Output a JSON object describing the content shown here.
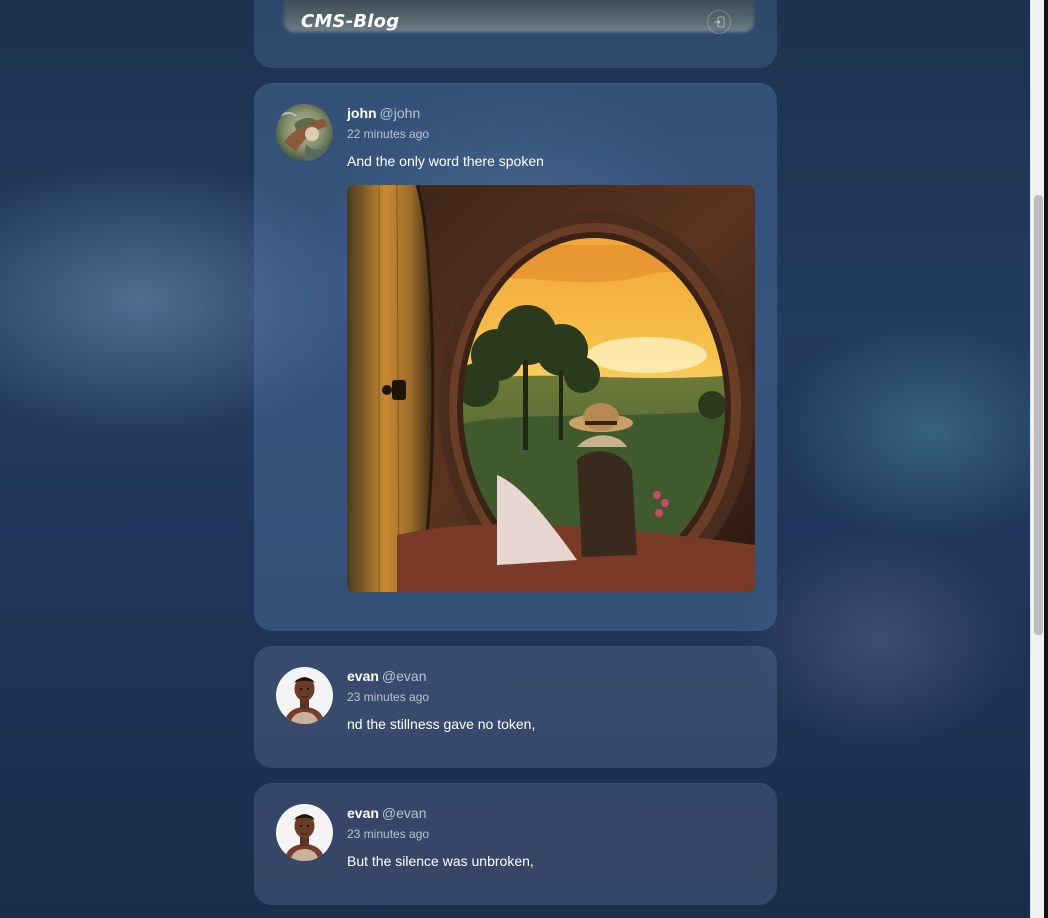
{
  "app": {
    "logo": "CMS-Blog",
    "login_icon": "login-icon"
  },
  "posts": [
    {
      "author": "john",
      "handle": "@john",
      "time": "22 minutes ago",
      "text": "And the only word there spoken",
      "has_image": true,
      "avatar_icon": "user-avatar-john"
    },
    {
      "author": "evan",
      "handle": "@evan",
      "time": "23 minutes ago",
      "text": "nd the stillness gave no token,",
      "has_image": false,
      "avatar_icon": "user-avatar-evan"
    },
    {
      "author": "evan",
      "handle": "@evan",
      "time": "23 minutes ago",
      "text": "But the silence was unbroken,",
      "has_image": false,
      "avatar_icon": "user-avatar-evan"
    }
  ],
  "colors": {
    "background": "#213659",
    "card": "#4a6488",
    "text": "#ffffff",
    "muted": "#b8c3d2"
  }
}
